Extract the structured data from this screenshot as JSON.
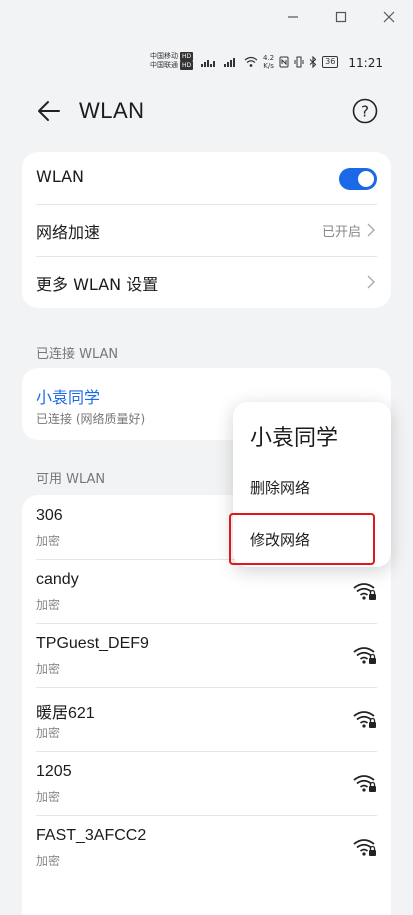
{
  "status_bar": {
    "carrier1": "中国移动",
    "carrier2": "中国联通",
    "hd": "HD",
    "speed_value": "4.2",
    "speed_unit": "K/s",
    "battery": "36",
    "time": "11:21"
  },
  "header": {
    "title": "WLAN"
  },
  "settings": {
    "wlan_label": "WLAN",
    "accel_label": "网络加速",
    "accel_value": "已开启",
    "more_label": "更多 WLAN 设置"
  },
  "connected": {
    "section": "已连接 WLAN",
    "name": "小袁同学",
    "status": "已连接 (网络质量好)"
  },
  "available": {
    "section": "可用 WLAN",
    "networks": [
      {
        "name": "306",
        "security": "加密"
      },
      {
        "name": "candy",
        "security": "加密"
      },
      {
        "name": "TPGuest_DEF9",
        "security": "加密"
      },
      {
        "name": "暖居621",
        "security": "加密"
      },
      {
        "name": "1205",
        "security": "加密"
      },
      {
        "name": "FAST_3AFCC2",
        "security": "加密"
      }
    ]
  },
  "popup": {
    "title": "小袁同学",
    "delete": "删除网络",
    "modify": "修改网络"
  },
  "colors": {
    "accent": "#1a69e6",
    "highlight": "#e01818"
  }
}
